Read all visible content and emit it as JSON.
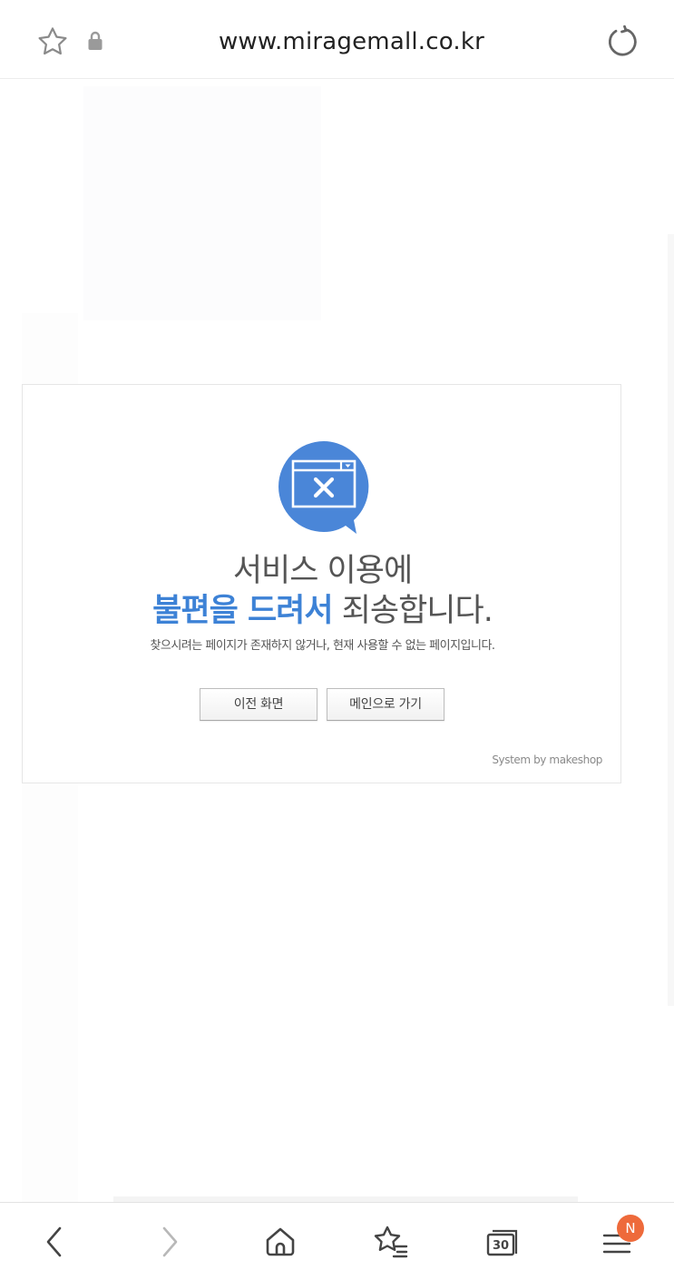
{
  "browser": {
    "url": "www.miragemall.co.kr",
    "icons": {
      "bookmark_star": "star-outline-icon",
      "lock": "lock-icon",
      "reload": "reload-icon"
    }
  },
  "error_card": {
    "icon": "browser-window-x-icon",
    "title_line1": "서비스 이용에",
    "title_highlight": "불편을 드려서",
    "title_rest": " 죄송합니다.",
    "description": "찾으시려는 페이지가 존재하지 않거나, 현재 사용할 수 없는 페이지입니다.",
    "buttons": {
      "previous": "이전 화면",
      "main": "메인으로 가기"
    },
    "footer": "System by makeshop",
    "colors": {
      "accent": "#3d82d6",
      "icon_bg": "#4a86d8"
    }
  },
  "bottom_nav": {
    "tabs_count": "30",
    "menu_badge": "N",
    "badge_color": "#ee6a3b",
    "icons": [
      "back-icon",
      "forward-icon",
      "home-icon",
      "bookmarks-icon",
      "tabs-icon",
      "menu-icon"
    ]
  }
}
